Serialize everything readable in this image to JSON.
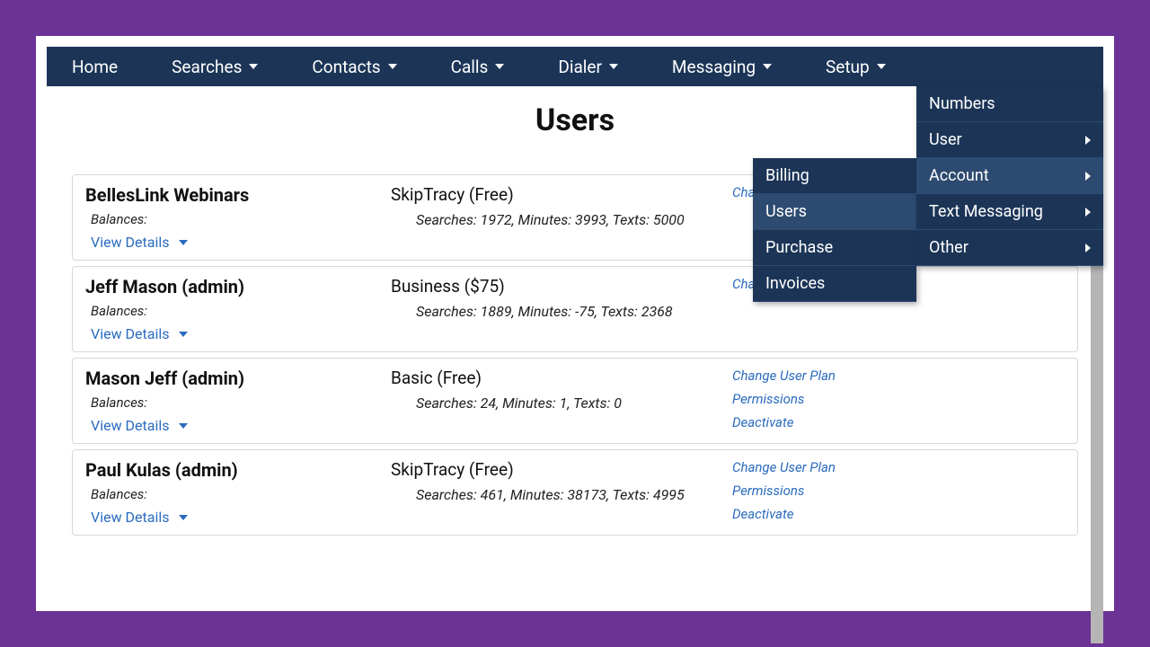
{
  "nav": {
    "home": "Home",
    "searches": "Searches",
    "contacts": "Contacts",
    "calls": "Calls",
    "dialer": "Dialer",
    "messaging": "Messaging",
    "setup": "Setup"
  },
  "page_title": "Users",
  "setup_menu": {
    "numbers": "Numbers",
    "user": "User",
    "account": "Account",
    "text_messaging": "Text Messaging",
    "other": "Other"
  },
  "account_menu": {
    "billing": "Billing",
    "users": "Users",
    "purchase": "Purchase",
    "invoices": "Invoices"
  },
  "labels": {
    "balances": "Balances:",
    "view_details": "View Details",
    "change_your_plan": "Change Your Plan",
    "change_user_plan": "Change User Plan",
    "permissions": "Permissions",
    "deactivate": "Deactivate"
  },
  "users": [
    {
      "name": "BellesLink Webinars",
      "plan": "SkipTracy (Free)",
      "balances": "Searches: 1972, Minutes: 3993, Texts: 5000",
      "actions": [
        "change_your_plan"
      ]
    },
    {
      "name": "Jeff Mason (admin)",
      "plan": "Business ($75)",
      "balances": "Searches: 1889, Minutes: -75, Texts: 2368",
      "actions": [
        "change_your_plan"
      ]
    },
    {
      "name": "Mason Jeff (admin)",
      "plan": "Basic (Free)",
      "balances": "Searches: 24, Minutes: 1, Texts: 0",
      "actions": [
        "change_user_plan",
        "permissions",
        "deactivate"
      ]
    },
    {
      "name": "Paul Kulas (admin)",
      "plan": "SkipTracy (Free)",
      "balances": "Searches: 461, Minutes: 38173, Texts: 4995",
      "actions": [
        "change_user_plan",
        "permissions",
        "deactivate"
      ]
    }
  ]
}
